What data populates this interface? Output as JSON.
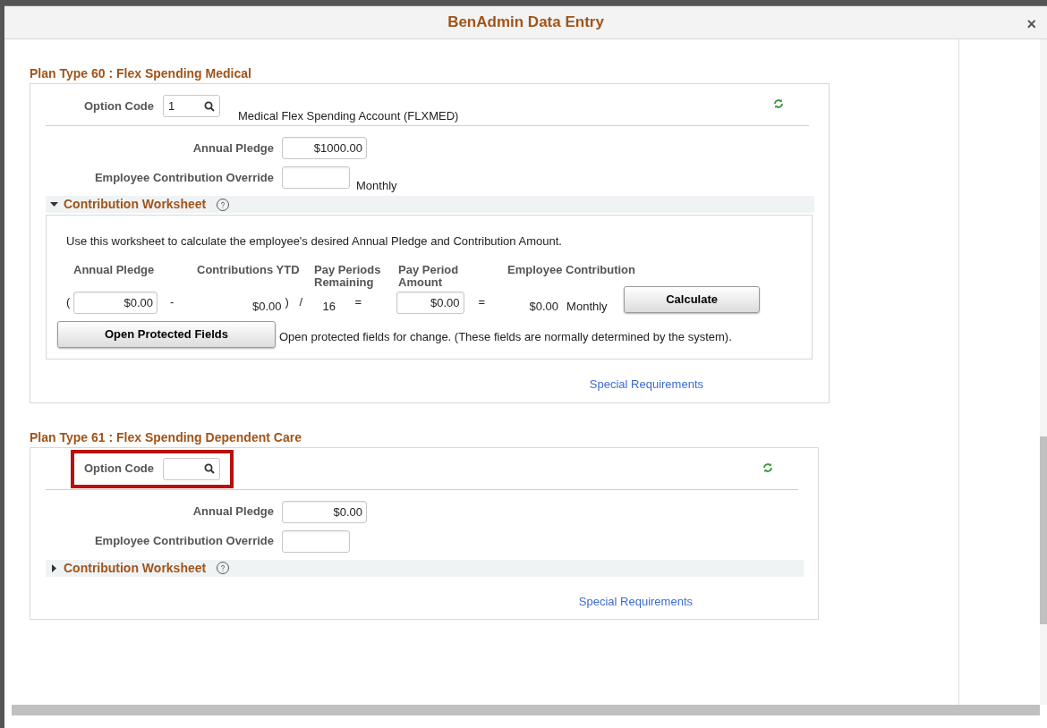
{
  "window": {
    "title": "BenAdmin Data Entry",
    "close": "×"
  },
  "plans": [
    {
      "title": "Plan Type 60 : Flex Spending Medical",
      "option_code": {
        "label": "Option Code",
        "value": "1",
        "highlighted": false
      },
      "option_description": "Medical Flex Spending Account (FLXMED)",
      "annual_pledge": {
        "label": "Annual Pledge",
        "value": "$1000.00"
      },
      "override": {
        "label": "Employee Contribution Override",
        "unit": "Monthly"
      },
      "worksheet": {
        "title": "Contribution Worksheet",
        "expanded": true,
        "intro": "Use this worksheet to calculate the employee's desired Annual Pledge and Contribution Amount.",
        "headers": [
          "Annual Pledge",
          "Contributions YTD",
          "Pay Periods Remaining",
          "Pay Period Amount",
          "Employee Contribution"
        ],
        "open_paren": "(",
        "annual_pledge": "$0.00",
        "minus": "-",
        "ytd": "$0.00",
        "close_paren": ")",
        "divide": "/",
        "remaining": "16",
        "equals_1": "=",
        "period_amount": "$0.00",
        "equals_2": "=",
        "employee_contribution": "$0.00",
        "frequency": "Monthly",
        "calculate": "Calculate",
        "open_protected": "Open Protected Fields",
        "open_protected_note": "Open protected fields for change.  (These fields are normally determined by the system)."
      },
      "link": "Special Requirements"
    },
    {
      "title": "Plan Type 61 : Flex Spending Dependent Care",
      "option_code": {
        "label": "Option Code",
        "highlighted": true
      },
      "annual_pledge": {
        "label": "Annual Pledge",
        "value": "$0.00"
      },
      "override": {
        "label": "Employee Contribution Override"
      },
      "worksheet": {
        "title": "Contribution Worksheet",
        "expanded": false
      },
      "link": "Special Requirements"
    }
  ]
}
